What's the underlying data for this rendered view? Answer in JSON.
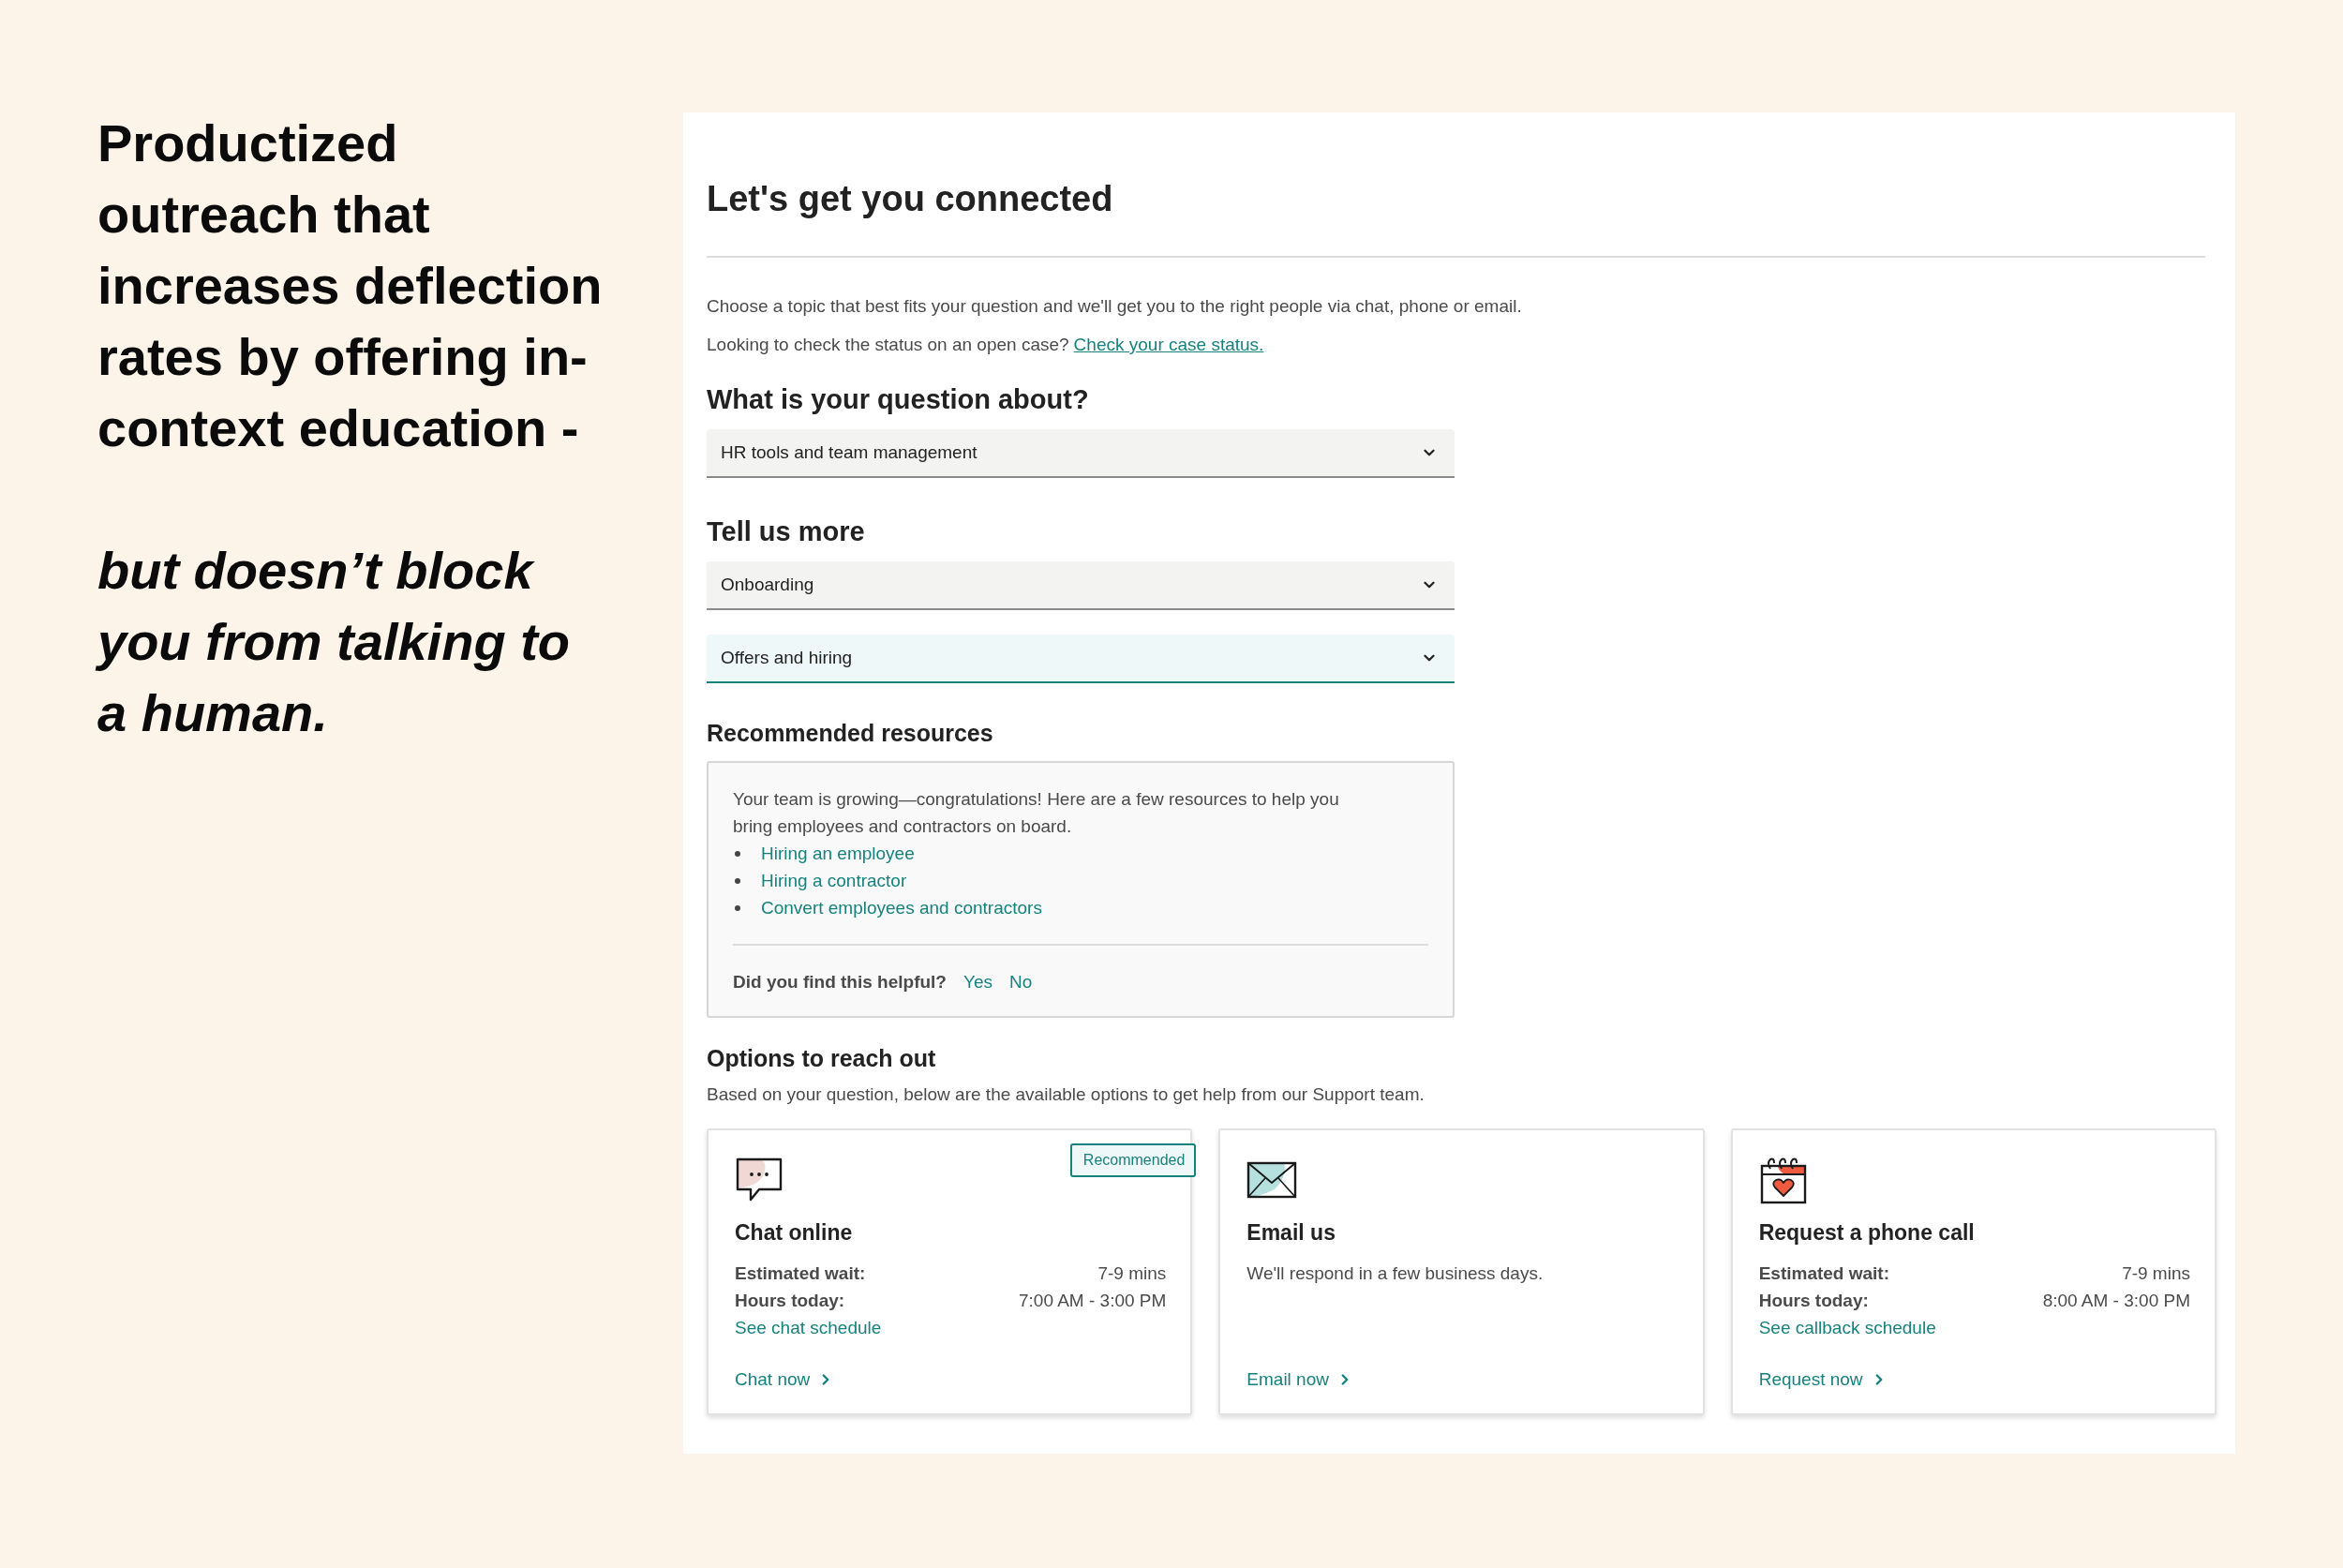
{
  "slide": {
    "headline": "Productized outreach that increases deflection rates by offering in-context education -",
    "tagline": "but doesn’t block you from talking to a human."
  },
  "panel": {
    "title": "Let's get you connected",
    "intro": "Choose a topic that best fits your question and we'll get you to the right people via chat, phone or email.",
    "case_status": {
      "prompt": "Looking to check the status on an open case?",
      "link": "Check your case status."
    },
    "question": {
      "label": "What is your question about?",
      "dropdowns": [
        {
          "value": "HR tools and team management",
          "focused": false
        }
      ]
    },
    "details": {
      "label": "Tell us more",
      "dropdowns": [
        {
          "value": "Onboarding",
          "focused": false
        },
        {
          "value": "Offers and hiring",
          "focused": true
        }
      ]
    },
    "resources": {
      "heading": "Recommended resources",
      "message": "Your team is growing—congratulations! Here are a few resources to help you bring employees and contractors on board.",
      "links": [
        "Hiring an employee",
        "Hiring a contractor",
        "Convert employees and contractors"
      ],
      "feedback": {
        "question": "Did you find this helpful?",
        "options": [
          "Yes",
          "No"
        ]
      }
    },
    "options": {
      "heading": "Options to reach out",
      "description": "Based on your question, below are the available options to get help from our Support team.",
      "cards": [
        {
          "kind": "chat",
          "title": "Chat online",
          "badge": "Recommended",
          "details": [
            {
              "label": "Estimated wait:",
              "value": "7-9 mins"
            },
            {
              "label": "Hours today:",
              "value": "7:00 AM - 3:00 PM"
            }
          ],
          "schedule_link": "See chat schedule",
          "action": "Chat now"
        },
        {
          "kind": "email",
          "title": "Email us",
          "description": "We'll respond in a few business days.",
          "action": "Email now"
        },
        {
          "kind": "phone",
          "title": "Request a phone call",
          "details": [
            {
              "label": "Estimated wait:",
              "value": "7-9 mins"
            },
            {
              "label": "Hours today:",
              "value": "8:00 AM - 3:00 PM"
            }
          ],
          "schedule_link": "See callback schedule",
          "action": "Request now"
        }
      ]
    }
  }
}
